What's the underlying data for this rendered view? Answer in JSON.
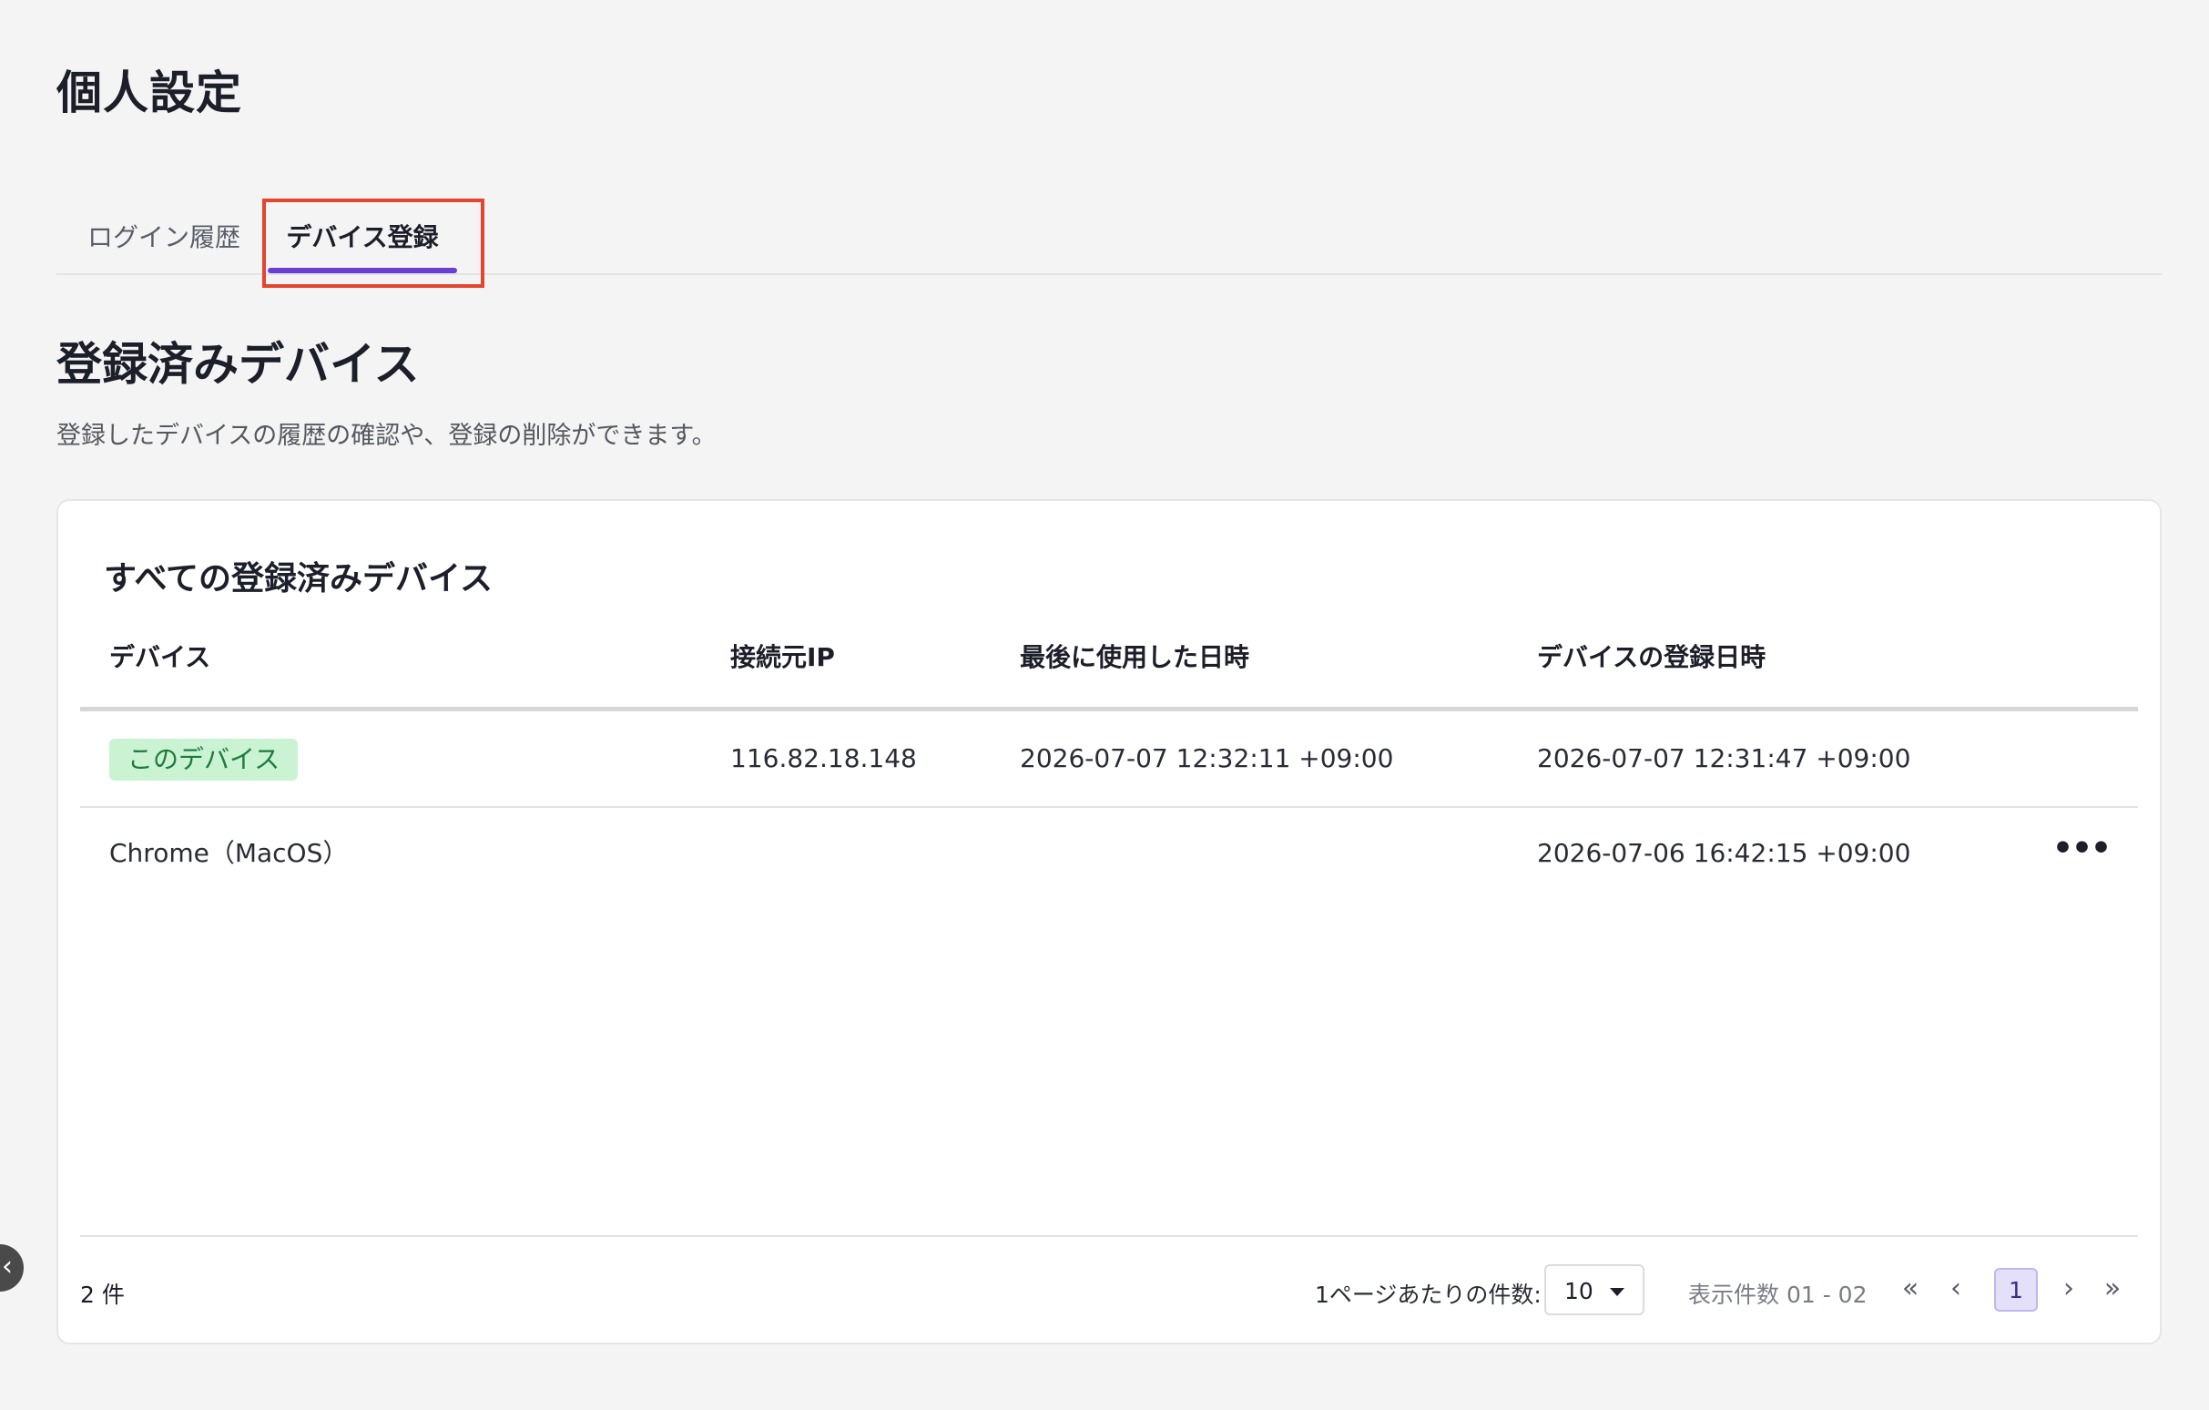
{
  "page": {
    "title": "個人設定"
  },
  "tabs": [
    {
      "label": "ログイン履歴",
      "active": false
    },
    {
      "label": "デバイス登録",
      "active": true
    }
  ],
  "section": {
    "title": "登録済みデバイス",
    "description": "登録したデバイスの履歴の確認や、登録の削除ができます。"
  },
  "card": {
    "title": "すべての登録済みデバイス",
    "columns": [
      "デバイス",
      "接続元IP",
      "最後に使用した日時",
      "デバイスの登録日時"
    ],
    "rows": [
      {
        "device": "このデバイス",
        "device_is_badge": true,
        "ip": "116.82.18.148",
        "last_used": "2026-07-07 12:32:11 +09:00",
        "registered": "2026-07-07 12:31:47 +09:00",
        "has_menu": false
      },
      {
        "device": "Chrome（MacOS）",
        "device_is_badge": false,
        "ip": "",
        "last_used": "",
        "registered": "2026-07-06 16:42:15 +09:00",
        "has_menu": true
      }
    ],
    "footer": {
      "total": "2 件",
      "per_page_label": "1ページあたりの件数:",
      "per_page_value": "10",
      "range": "表示件数 01 - 02",
      "current_page": "1"
    }
  },
  "icons": {
    "more": "more-horizontal-icon",
    "first": "double-chevron-left-icon",
    "prev": "chevron-left-icon",
    "next": "chevron-right-icon",
    "last": "double-chevron-right-icon",
    "handle": "chevron-left-icon"
  },
  "colors": {
    "accent": "#6a3fd0",
    "highlight": "#e3452f",
    "badge_bg": "#c9f3d3",
    "badge_text": "#1e7a3b"
  }
}
